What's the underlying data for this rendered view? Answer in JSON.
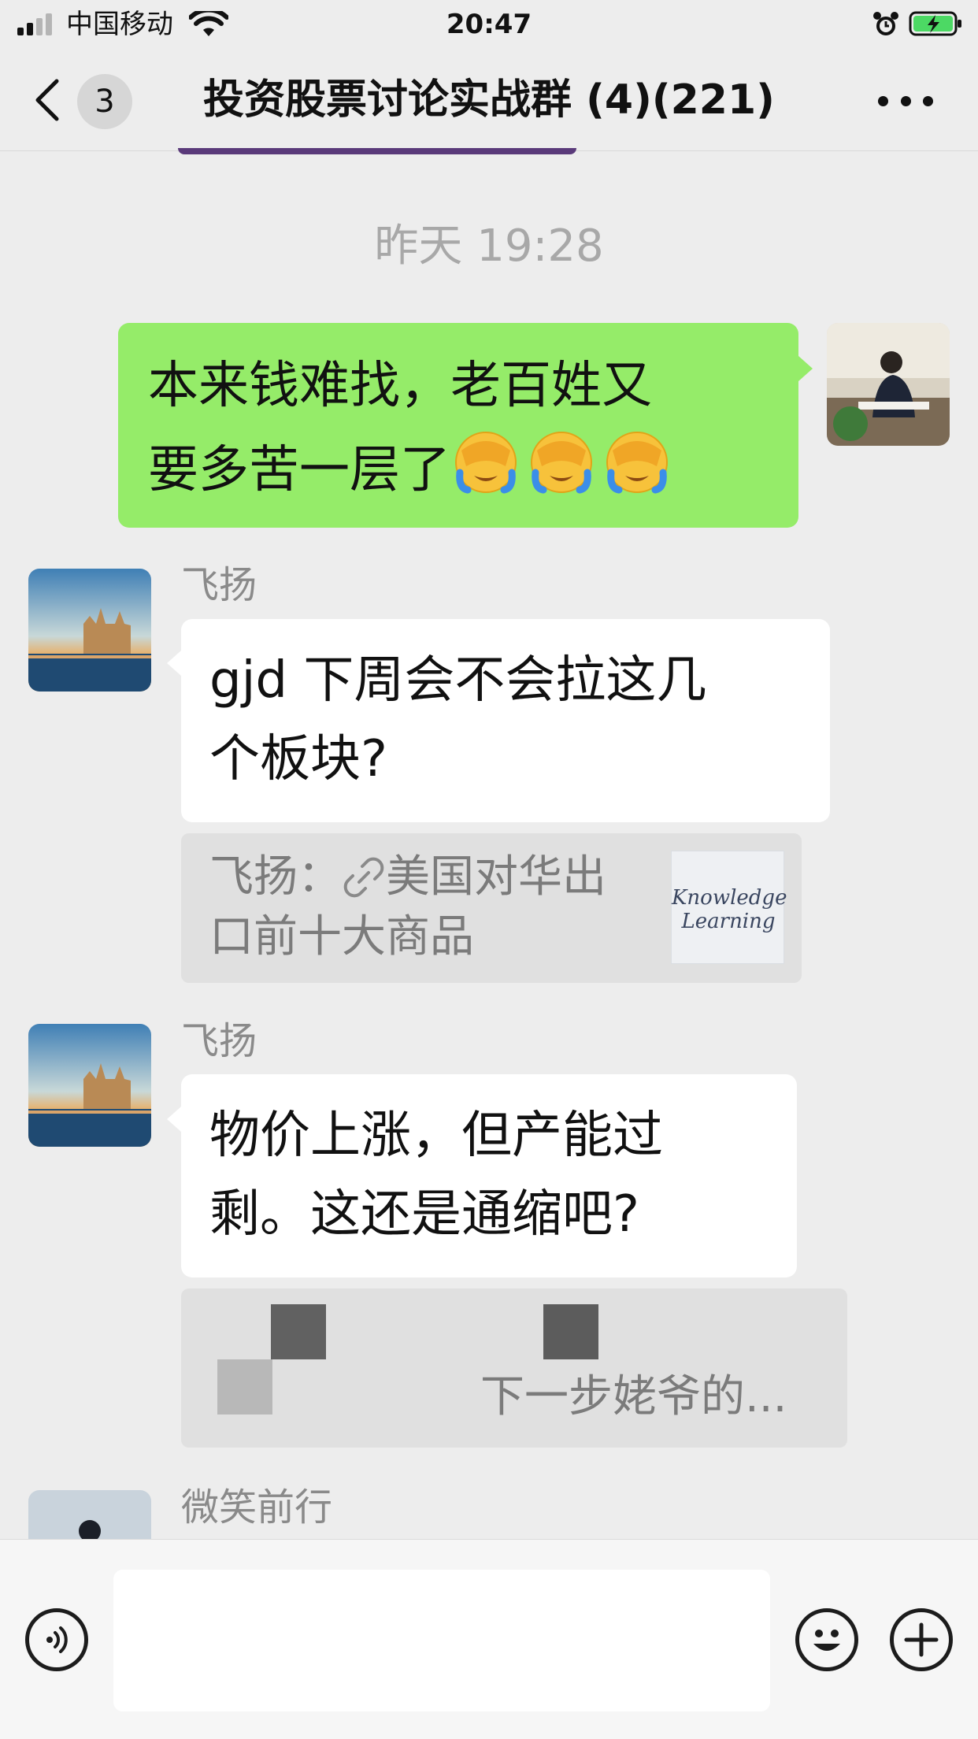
{
  "status_bar": {
    "carrier": "中国移动",
    "time": "20:47",
    "icons": [
      "signal-icon",
      "wifi-icon",
      "alarm-icon",
      "battery-charging-icon"
    ]
  },
  "nav": {
    "unread_count": "3",
    "title": "投资股票讨论实战群 (4)(221)",
    "icons": [
      "back-chevron-icon",
      "more-icon"
    ]
  },
  "messages": {
    "timestamp": "昨天 19:28",
    "m1": {
      "line1": "本来钱难找，老百姓又",
      "line2": "要多苦一层了",
      "emoji": "facepalm-emoji"
    },
    "m2": {
      "sender": "飞扬",
      "line1": "gjd 下周会不会拉这几",
      "line2": "个板块?",
      "quote": {
        "prefix": "飞扬：",
        "line1": "美国对华出",
        "line2": "口前十大商品",
        "thumb_line1": "Knowledge",
        "thumb_line2": "Learning"
      }
    },
    "m3": {
      "sender": "飞扬",
      "line1": "物价上涨，但产能过",
      "line2": "剩。这还是通缩吧?",
      "quote": {
        "text": "下一步姥爷的..."
      }
    },
    "m4": {
      "sender": "微笑前行"
    }
  },
  "input_bar": {
    "icons": [
      "voice-icon",
      "emoji-icon",
      "plus-icon"
    ]
  },
  "colors": {
    "background": "#ededed",
    "my_bubble": "#95ec69",
    "their_bubble": "#ffffff",
    "quote_bg": "#e0e0e0",
    "muted_text": "#a8a8a8"
  }
}
